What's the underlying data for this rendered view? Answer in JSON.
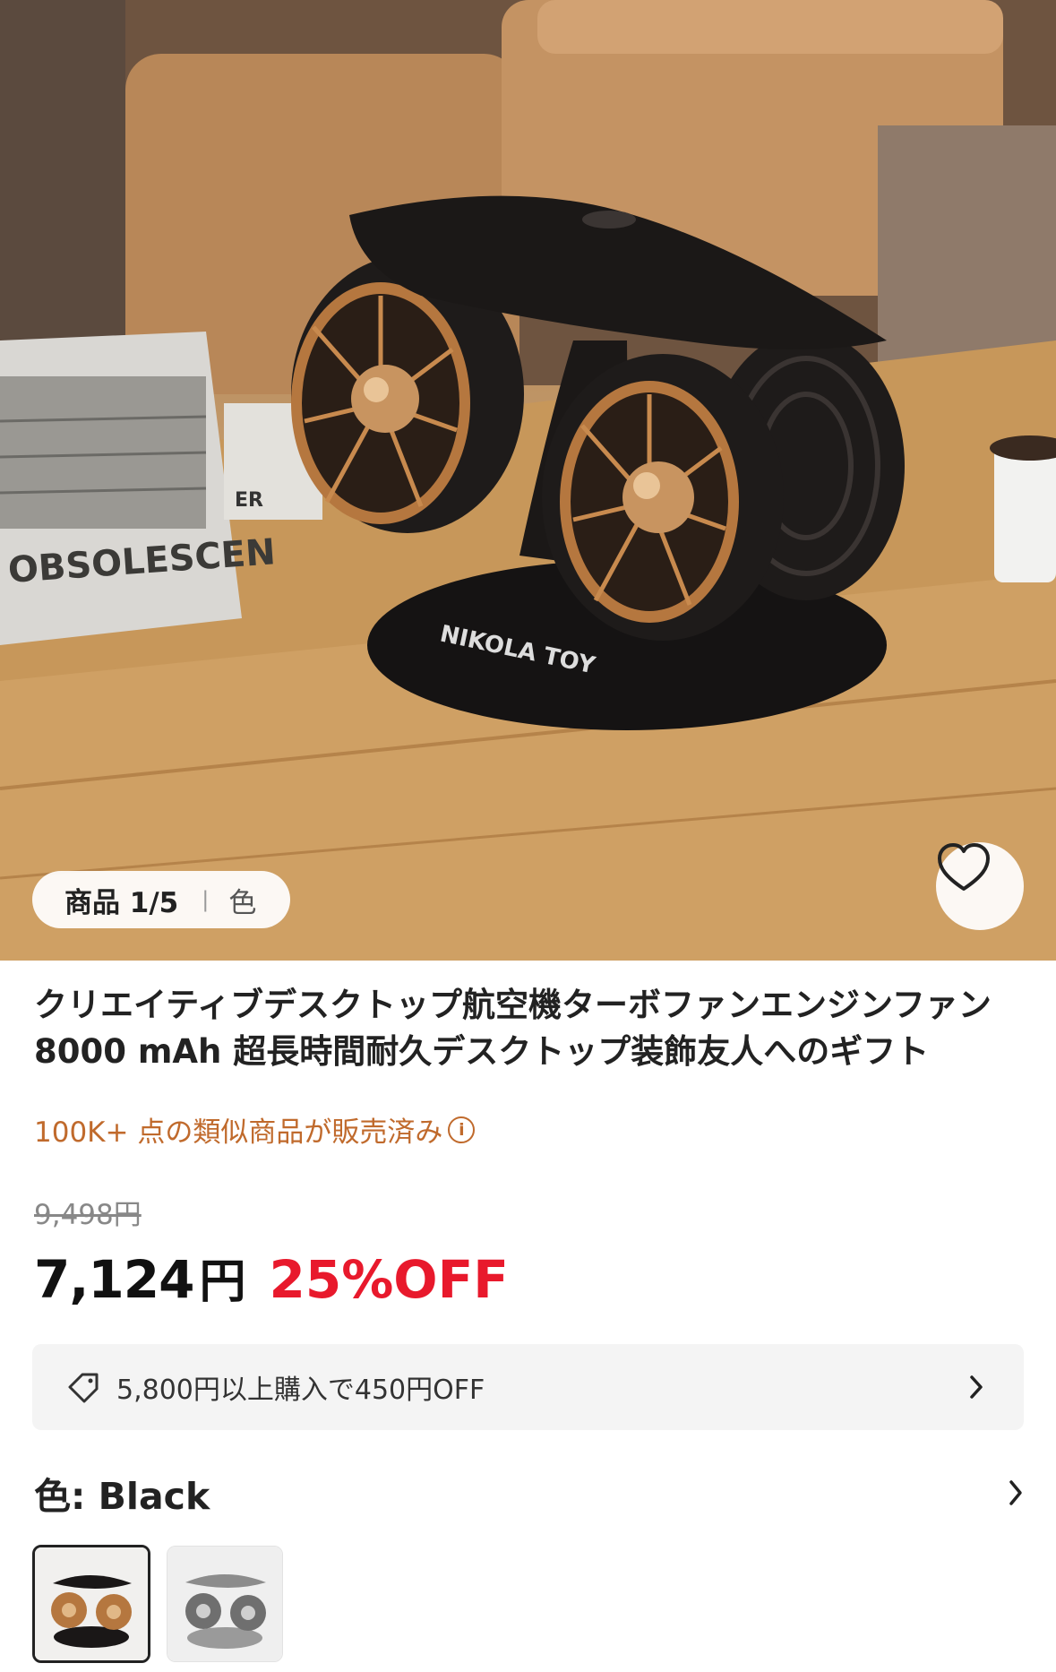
{
  "gallery": {
    "counter": "商品 1/5",
    "tab_color": "色",
    "favorite_icon": "heart-outline-icon",
    "book_text": "OBSOLESCEN",
    "brand_text": "NIKOLA TOY",
    "box_text": "ER"
  },
  "product": {
    "title": "クリエイティブデスクトップ航空機ターボファンエンジンファン 8000 mAh 超長時間耐久デスクトップ装飾友人へのギフト",
    "sold": "100K+ 点の類似商品が販売済み",
    "info_icon": "info-icon",
    "original_price": "9,498円",
    "price_number": "7,124",
    "price_unit": "円",
    "discount": "25%OFF"
  },
  "coupon": {
    "icon": "tag-icon",
    "text": "5,800円以上購入で450円OFF"
  },
  "color": {
    "label": "色: Black",
    "options": [
      "Black",
      "Gray"
    ],
    "selected": "Black"
  },
  "colors": {
    "accent_red": "#e8192c",
    "sold_orange": "#c06a2c",
    "coupon_bg": "#f4f4f4"
  }
}
